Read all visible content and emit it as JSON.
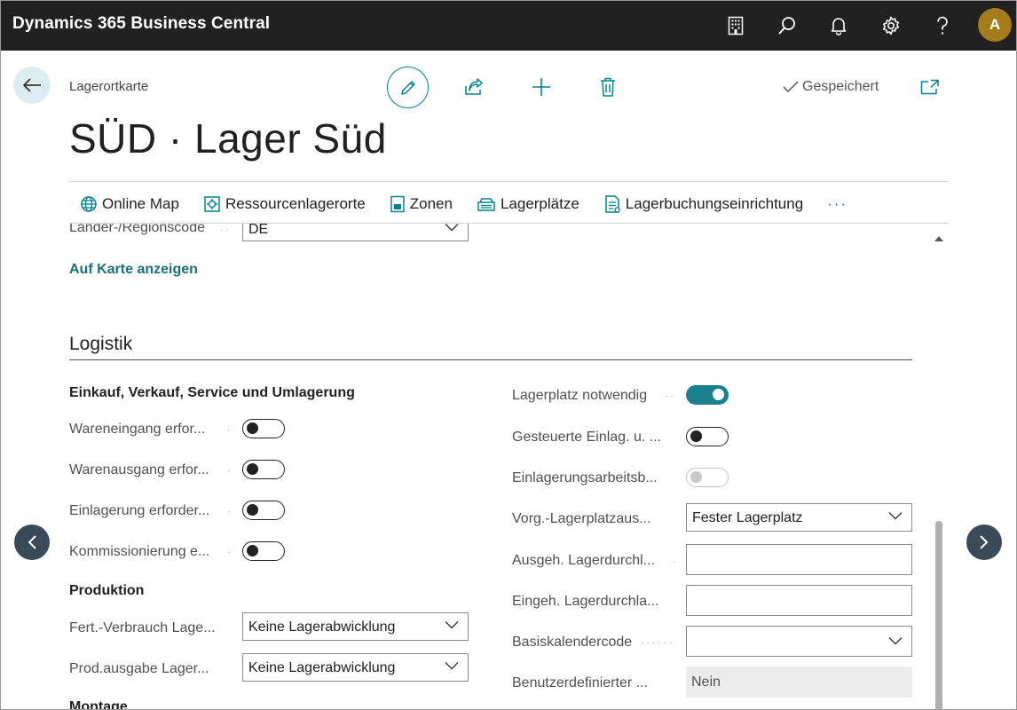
{
  "app": {
    "title": "Dynamics 365 Business Central",
    "avatar_initial": "A"
  },
  "topbar_icons": [
    "building-icon",
    "search-icon",
    "bell-icon",
    "gear-icon",
    "help-icon"
  ],
  "header": {
    "caption": "Lagerortkarte",
    "title": "SÜD · Lager Süd",
    "saved_label": "Gespeichert"
  },
  "actions": [
    {
      "label": "Online Map",
      "icon": "globe-icon"
    },
    {
      "label": "Ressourcenlagerorte",
      "icon": "resource-location-icon"
    },
    {
      "label": "Zonen",
      "icon": "zones-icon"
    },
    {
      "label": "Lagerplätze",
      "icon": "bins-icon"
    },
    {
      "label": "Lagerbuchungseinrichtung",
      "icon": "posting-setup-icon"
    }
  ],
  "more_label": "···",
  "address": {
    "country_label": "Länder-/Regionscode",
    "country_value": "DE",
    "show_map_link": "Auf Karte anzeigen"
  },
  "logistics": {
    "section_title": "Logistik",
    "purchase_group": {
      "title": "Einkauf, Verkauf, Service und Umlagerung",
      "fields": [
        {
          "label": "Wareneingang erfor...",
          "value": false
        },
        {
          "label": "Warenausgang erfor...",
          "value": false
        },
        {
          "label": "Einlagerung erforder...",
          "value": false
        },
        {
          "label": "Kommissionierung e...",
          "value": false
        }
      ]
    },
    "production_group": {
      "title": "Produktion",
      "fields": [
        {
          "label": "Fert.-Verbrauch Lage...",
          "value": "Keine Lagerabwicklung"
        },
        {
          "label": "Prod.ausgabe Lager...",
          "value": "Keine Lagerabwicklung"
        }
      ]
    },
    "assembly_title": "Montage",
    "right_fields": {
      "bin_mandatory": {
        "label": "Lagerplatz notwendig",
        "value": true
      },
      "directed_putaway": {
        "label": "Gesteuerte Einlag. u. ...",
        "value": false
      },
      "putaway_worksheet": {
        "label": "Einlagerungsarbeitsb...",
        "value": false
      },
      "default_bin_selection": {
        "label": "Vorg.-Lagerplatzaus...",
        "value": "Fester Lagerplatz"
      },
      "outbound_lead_time": {
        "label": "Ausgeh. Lagerdurchl...",
        "value": ""
      },
      "inbound_lead_time": {
        "label": "Eingeh. Lagerdurchla...",
        "value": ""
      },
      "base_calendar": {
        "label": "Basiskalendercode",
        "value": ""
      },
      "custom_calendar": {
        "label": "Benutzerdefinierter ...",
        "value": "Nein"
      }
    }
  },
  "colors": {
    "accent": "#00838f",
    "toggle_on": "#1b7f8d",
    "topbar": "#212121",
    "avatar": "#a57c1b"
  }
}
